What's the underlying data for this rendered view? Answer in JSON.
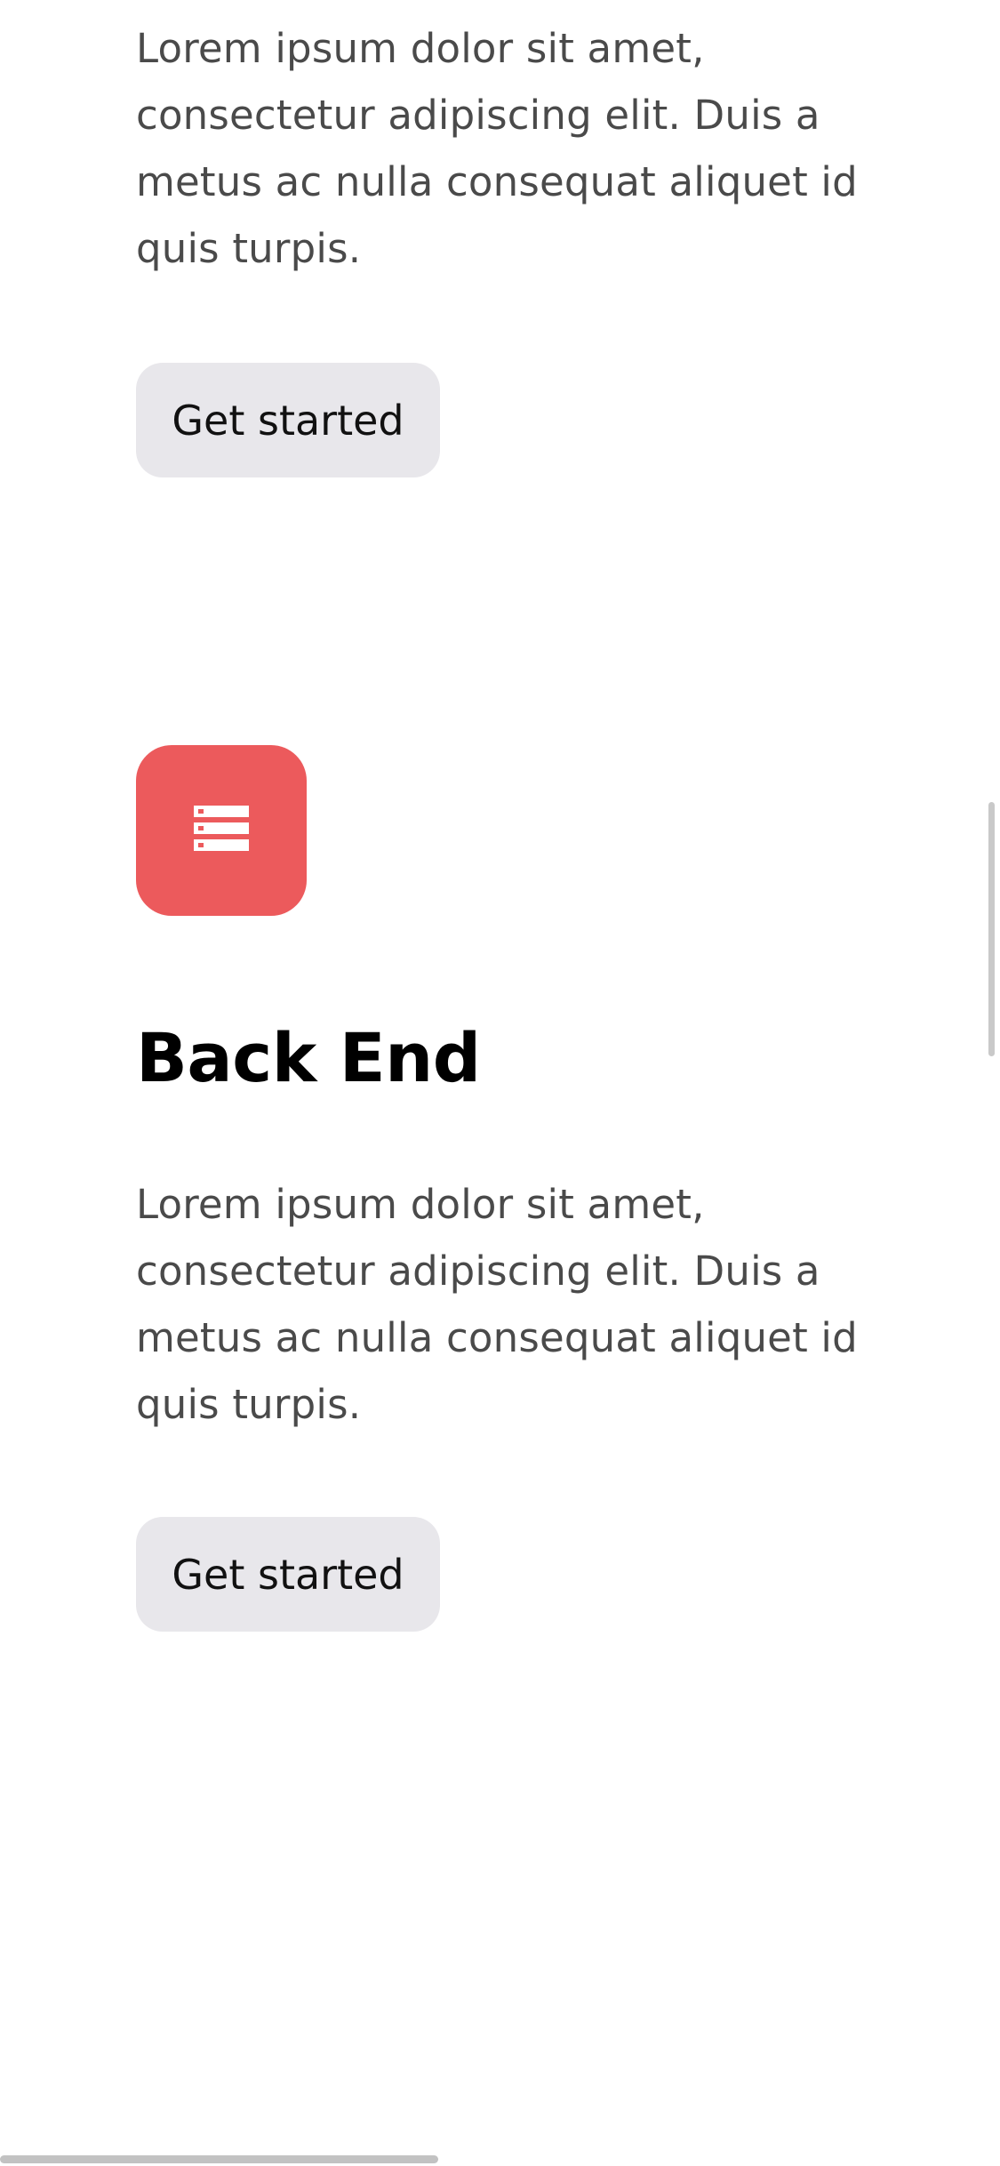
{
  "colors": {
    "icon_background": "#ec5a5c",
    "button_background": "#e8e7eb",
    "body_text": "#4a4a4a",
    "heading_text": "#000000"
  },
  "sections": [
    {
      "description": "Lorem ipsum dolor sit amet, consectetur adipiscing elit. Duis a metus ac nulla consequat aliquet id quis turpis.",
      "button_label": "Get started"
    },
    {
      "icon": "server-icon",
      "title": "Back End",
      "description": "Lorem ipsum dolor sit amet, consectetur adipiscing elit. Duis a metus ac nulla consequat aliquet id quis turpis.",
      "button_label": "Get started"
    }
  ]
}
